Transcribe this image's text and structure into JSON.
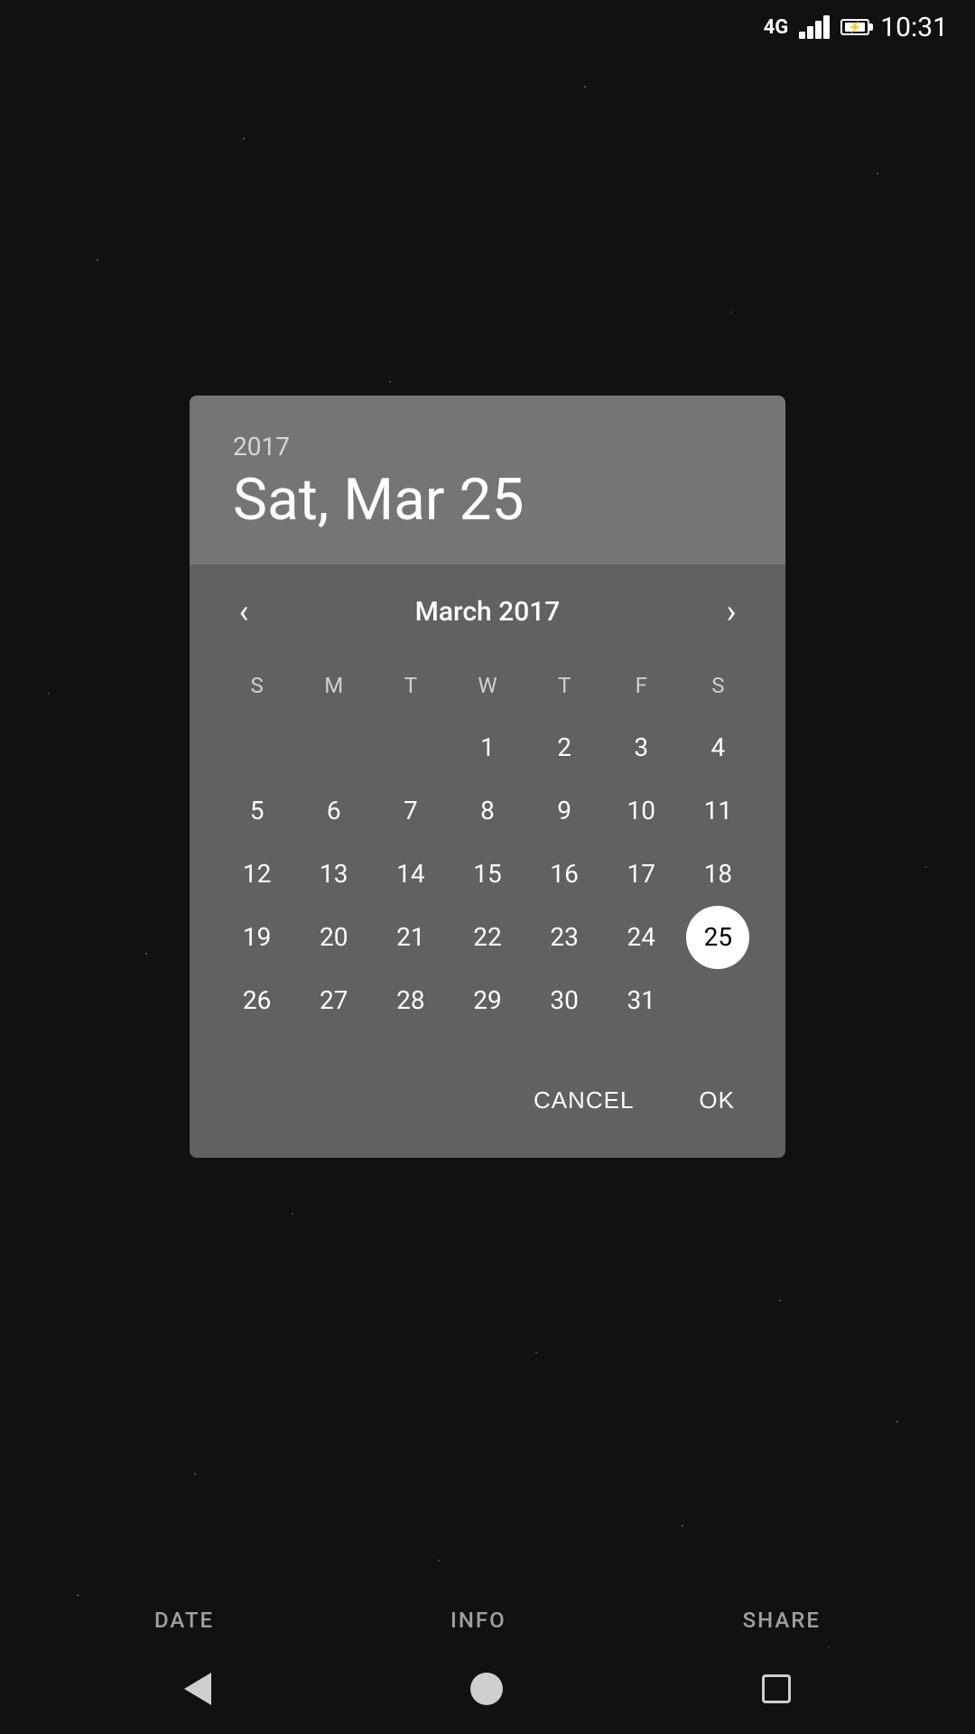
{
  "statusBar": {
    "signal": "4G",
    "time": "10:31"
  },
  "dialog": {
    "year": "2017",
    "dateDisplay": "Sat, Mar 25",
    "monthTitle": "March 2017",
    "selectedDay": 25,
    "weekdays": [
      "S",
      "M",
      "T",
      "W",
      "T",
      "F",
      "S"
    ],
    "calendarDays": [
      null,
      null,
      null,
      1,
      2,
      3,
      4,
      5,
      6,
      7,
      8,
      9,
      10,
      11,
      12,
      13,
      14,
      15,
      16,
      17,
      18,
      19,
      20,
      21,
      22,
      23,
      24,
      25,
      26,
      27,
      28,
      29,
      30,
      31,
      null
    ],
    "cancelLabel": "CANCEL",
    "okLabel": "OK"
  },
  "bottomTabs": {
    "date": "DATE",
    "info": "INFO",
    "share": "SHARE"
  }
}
